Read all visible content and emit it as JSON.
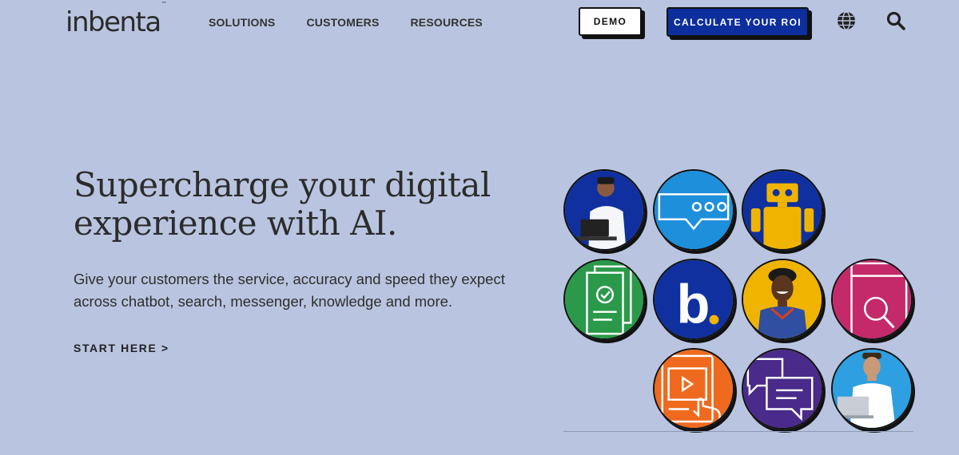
{
  "header": {
    "logo": "inbenta",
    "logo_tm": "™",
    "nav": [
      "SOLUTIONS",
      "CUSTOMERS",
      "RESOURCES"
    ],
    "demo_button": "DEMO",
    "roi_button": "CALCULATE YOUR ROI",
    "icons": [
      "globe-icon",
      "search-icon"
    ]
  },
  "hero": {
    "title": "Supercharge your digital experience with AI.",
    "subtitle": "Give your customers the service, accuracy and speed they expect across chatbot, search, messenger, knowledge and more.",
    "cta": "START HERE >"
  },
  "colors": {
    "background": "#b9c5e0",
    "primary_button": "#0d2e9c",
    "circle_blue": "#1030a0",
    "circle_light_blue": "#1e8fdb",
    "circle_green": "#2a9a4a",
    "circle_yellow": "#f0b400",
    "circle_magenta": "#c42a6a",
    "circle_orange": "#ef6a1e",
    "circle_purple": "#4a2a8a",
    "circle_sky": "#2e9fe0"
  },
  "mosaic": [
    "person-laptop-photo",
    "chat-bubble-icon",
    "robot-icon",
    "document-check-icon",
    "brand-b-icon",
    "smiling-woman-photo",
    "mobile-search-icon",
    "video-touch-icon",
    "messages-icon",
    "man-laptop-photo"
  ],
  "brand_letter": "b"
}
